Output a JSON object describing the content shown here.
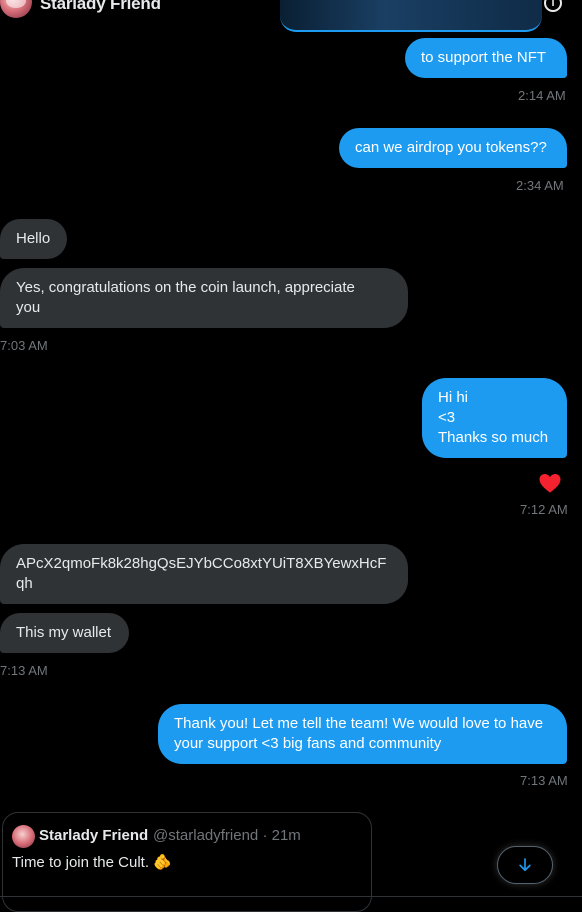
{
  "header": {
    "contact_name": "Starlady Friend",
    "avatar_icon": "avatar-icon",
    "info_icon": "info-icon",
    "info_glyph": "i"
  },
  "messages": [
    {
      "id": "m1",
      "dir": "out",
      "lines": [
        "to support the NFT"
      ],
      "time": "2:14 AM"
    },
    {
      "id": "m2",
      "dir": "out",
      "lines": [
        "can we airdrop you tokens??"
      ],
      "time": "2:34 AM"
    },
    {
      "id": "m3",
      "dir": "in",
      "lines": [
        "Hello"
      ]
    },
    {
      "id": "m4",
      "dir": "in",
      "lines": [
        "Yes, congratulations on the coin launch, appreciate",
        "you"
      ],
      "time": "7:03 AM"
    },
    {
      "id": "m5",
      "dir": "out",
      "lines": [
        "Hi hi",
        "<3",
        "Thanks so much"
      ],
      "reaction": "heart-icon",
      "time": "7:12 AM"
    },
    {
      "id": "m6",
      "dir": "in",
      "lines": [
        "APcX2qmoFk8k28hgQsEJYbCCo8xtYUiT8XBYewxHcF",
        "qh"
      ]
    },
    {
      "id": "m7",
      "dir": "in",
      "lines": [
        "This my wallet"
      ],
      "time": "7:13 AM"
    },
    {
      "id": "m8",
      "dir": "out",
      "lines": [
        "Thank you! Let me tell the team! We would love to have",
        "your support <3 big fans and community"
      ],
      "time": "7:13 AM"
    }
  ],
  "tweet": {
    "name": "Starlady Friend",
    "handle_time": "@starladyfriend · 21m",
    "text": "Time to join the Cult. 🫵"
  },
  "scroll_button": {
    "icon": "arrow-down-icon"
  },
  "colors": {
    "accent": "#1d9bf0",
    "incoming": "#2f3336",
    "background": "#000000",
    "muted": "#71767b",
    "heart": "#f91880"
  }
}
